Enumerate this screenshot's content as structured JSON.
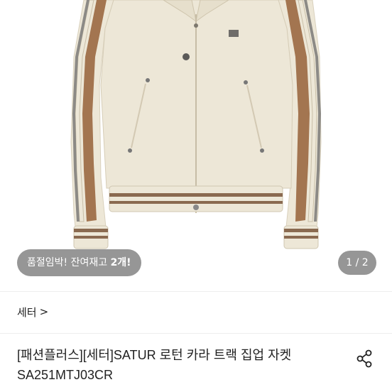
{
  "gallery": {
    "stock_notice_prefix": "품절임박! 잔여재고 ",
    "stock_count": "2개!",
    "page_counter": "1 / 2"
  },
  "category": {
    "label": "세터",
    "chevron": ">"
  },
  "product": {
    "title": "[패션플러스][세터]SATUR 로턴 카라 트랙 집업 자켓 SA251MTJ03CR"
  },
  "icons": {
    "share": "share-icon"
  },
  "colors": {
    "jacket_body": "#EDE7D7",
    "stripe_brown": "#A37550",
    "pill_background": "#7A7A7A"
  }
}
